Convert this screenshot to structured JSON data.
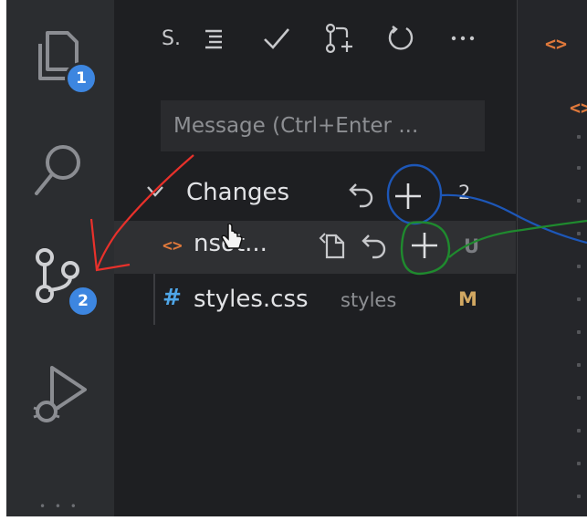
{
  "activity_bar": {
    "explorer_badge": "1",
    "source_control_badge": "2",
    "more": "• • •"
  },
  "scm": {
    "toolbar_title": "S.",
    "message_placeholder": "Message (Ctrl+Enter ...",
    "changes": {
      "label": "Changes",
      "count": "2"
    },
    "files": [
      {
        "name": "n",
        "name_rest": "sot...",
        "status": "U",
        "status_color": "#7b7d82"
      },
      {
        "name": "styles.css",
        "description": "styles",
        "status": "M",
        "status_color": "#d2a862"
      }
    ]
  },
  "editor": {
    "tab_icon": "<>",
    "tab_icon_2": "<>"
  },
  "colors": {
    "annotation_red": "#e8312b",
    "annotation_blue": "#1d57b8",
    "annotation_green": "#1f8a2e",
    "file_icon_orange": "#e0793b",
    "css_hash_blue": "#4fa6e8",
    "badge_blue": "#3d86e0"
  }
}
